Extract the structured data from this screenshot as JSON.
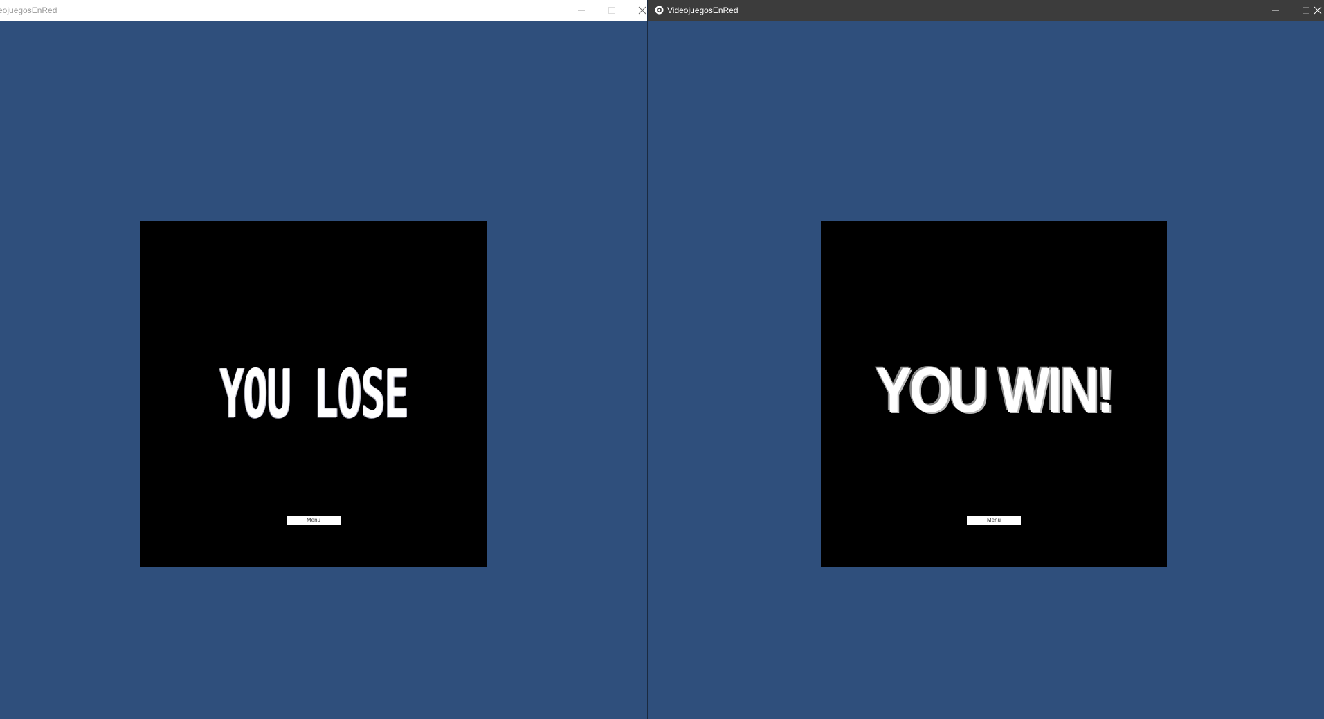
{
  "windows": {
    "left": {
      "title": "eojuegosEnRed",
      "message": "YOU LOSE",
      "menu_label": "Menu"
    },
    "right": {
      "title": "VideojuegosEnRed",
      "message": "YOU WIN!",
      "menu_label": "Menu"
    }
  },
  "colors": {
    "background": "#2f4f7c",
    "panel": "#000000",
    "text": "#ffffff"
  },
  "icons": {
    "app": "unity-icon",
    "minimize": "minimize-icon",
    "maximize": "maximize-icon",
    "close": "close-icon"
  }
}
